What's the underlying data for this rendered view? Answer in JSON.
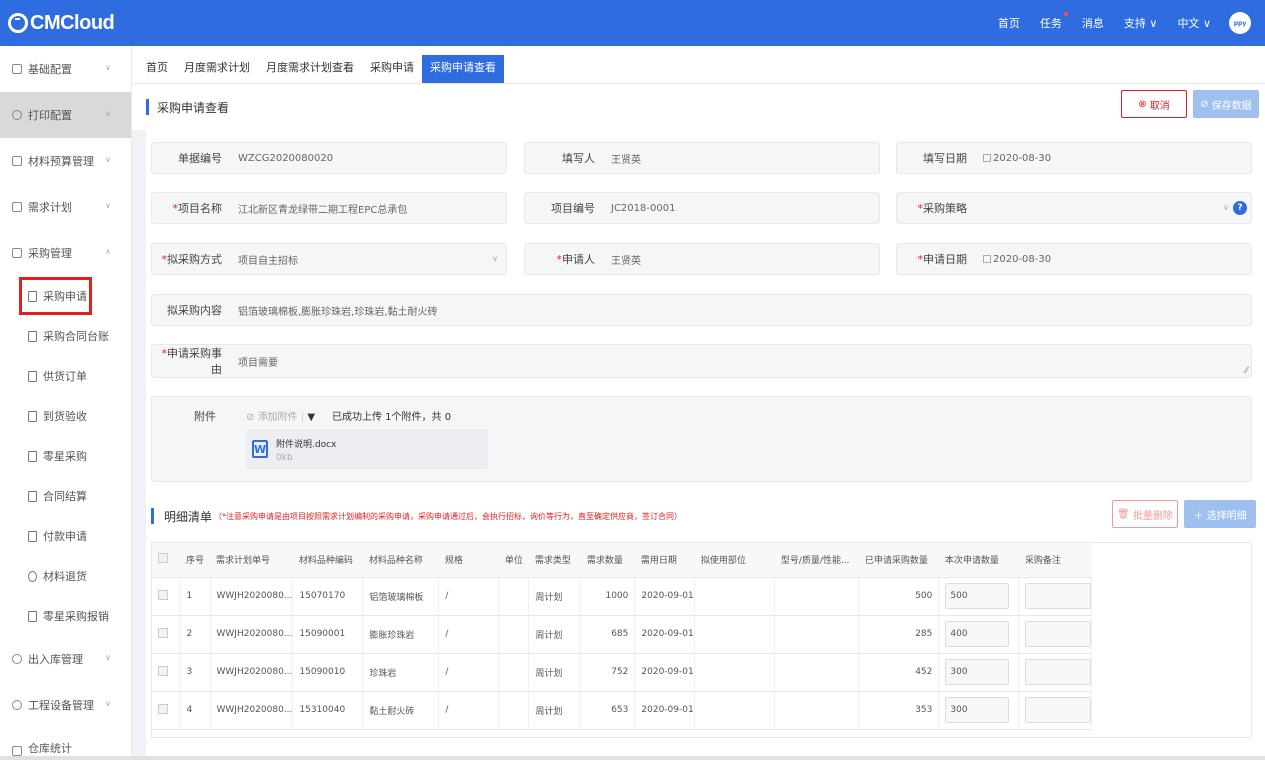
{
  "app": {
    "logo": "CMCloud"
  },
  "topnav": {
    "home": "首页",
    "tasks": "任务",
    "messages": "消息",
    "support": "支持",
    "language": "中文",
    "avatar_text": "ppy"
  },
  "sidebar": {
    "items": [
      {
        "label": "基础配置"
      },
      {
        "label": "打印配置"
      },
      {
        "label": "材料预算管理"
      },
      {
        "label": "需求计划"
      },
      {
        "label": "采购管理"
      }
    ],
    "subitems": [
      {
        "label": "采购申请"
      },
      {
        "label": "采购合同台账"
      },
      {
        "label": "供货订单"
      },
      {
        "label": "到货验收"
      },
      {
        "label": "零星采购"
      },
      {
        "label": "合同结算"
      },
      {
        "label": "付款申请"
      },
      {
        "label": "材料退货"
      },
      {
        "label": "零星采购报销"
      }
    ],
    "items_after": [
      {
        "label": "出入库管理"
      },
      {
        "label": "工程设备管理"
      },
      {
        "label": "仓库统计"
      }
    ]
  },
  "tabs": [
    "首页",
    "月度需求计划",
    "月度需求计划查看",
    "采购申请",
    "采购申请查看"
  ],
  "header": {
    "title": "采购申请查看",
    "cancel": "取消",
    "save": "保存数据"
  },
  "form": {
    "doc_no_label": "单据编号",
    "doc_no": "WZCG2020080020",
    "filler_label": "填写人",
    "filler": "王贤英",
    "fill_date_label": "填写日期",
    "fill_date": "2020-08-30",
    "project_name_label": "项目名称",
    "project_name": "江北新区青龙绿带二期工程EPC总承包",
    "project_no_label": "项目编号",
    "project_no": "JC2018-0001",
    "strategy_label": "采购策略",
    "strategy": "",
    "method_label": "拟采购方式",
    "method": "项目自主招标",
    "applicant_label": "申请人",
    "applicant": "王贤英",
    "apply_date_label": "申请日期",
    "apply_date": "2020-08-30",
    "content_label": "拟采购内容",
    "content": "铝箔玻璃棉板,膨胀珍珠岩,珍珠岩,黏土耐火砖",
    "reason_label": "申请采购事由",
    "reason": "项目需要",
    "attach_label": "附件",
    "add_attach": "添加附件",
    "uploaded_text": "已成功上传 1个附件，共 0",
    "file_name": "附件说明.docx",
    "file_size": "0kb"
  },
  "detail": {
    "title": "明细清单",
    "note": "（*注意采购申请是由项目按照需求计划编制的采购申请，采购申请通过后，会执行招标，询价等行为，直至确定供应商，签订合同）",
    "bulk_delete": "批量删除",
    "choose": "选择明细",
    "columns": [
      "序号",
      "需求计划单号",
      "材料品种编码",
      "材料品种名称",
      "规格",
      "单位",
      "需求类型",
      "需求数量",
      "需用日期",
      "拟使用部位",
      "型号/质量/性能...",
      "已申请采购数量",
      "本次申请数量",
      "采购备注"
    ],
    "rows": [
      {
        "no": "1",
        "plan_no": "WWJH2020080...",
        "code": "15070170",
        "name": "铝箔玻璃棉板",
        "spec": "/",
        "unit": "",
        "type": "周计划",
        "qty": "1000",
        "date": "2020-09-01",
        "part": "",
        "model": "",
        "applied": "500",
        "current": "500",
        "remark": ""
      },
      {
        "no": "2",
        "plan_no": "WWJH2020080...",
        "code": "15090001",
        "name": "膨胀珍珠岩",
        "spec": "/",
        "unit": "",
        "type": "周计划",
        "qty": "685",
        "date": "2020-09-01",
        "part": "",
        "model": "",
        "applied": "285",
        "current": "400",
        "remark": ""
      },
      {
        "no": "3",
        "plan_no": "WWJH2020080...",
        "code": "15090010",
        "name": "珍珠岩",
        "spec": "/",
        "unit": "",
        "type": "周计划",
        "qty": "752",
        "date": "2020-09-01",
        "part": "",
        "model": "",
        "applied": "452",
        "current": "300",
        "remark": ""
      },
      {
        "no": "4",
        "plan_no": "WWJH2020080...",
        "code": "15310040",
        "name": "黏土耐火砖",
        "spec": "/",
        "unit": "",
        "type": "周计划",
        "qty": "653",
        "date": "2020-09-01",
        "part": "",
        "model": "",
        "applied": "353",
        "current": "300",
        "remark": ""
      }
    ]
  },
  "colors": {
    "primary": "#2e6ce0",
    "danger": "#e02020",
    "disabled_primary": "#9fc0ef"
  }
}
